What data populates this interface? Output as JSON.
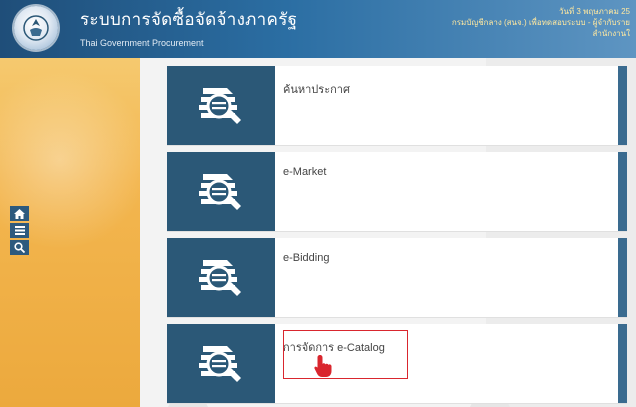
{
  "header": {
    "title_th": "ระบบการจัดซื้อจัดจ้างภาครัฐ",
    "title_en": "Thai Government Procurement",
    "info_line1": "วันที่ 3 พฤษภาคม 25",
    "info_line2": "กรมบัญชีกลาง (สนจ.) เพื่อทดสอบระบบ - ผู้จำกับราย",
    "info_line3": "สำนักงานใ",
    "logo_icon": "government-seal-icon"
  },
  "side_tools": [
    {
      "icon": "home-icon"
    },
    {
      "icon": "menu-icon"
    },
    {
      "icon": "search-icon"
    }
  ],
  "menu": [
    {
      "label": "ค้นหาประกาศ",
      "icon": "search-document-icon"
    },
    {
      "label": "e-Market",
      "icon": "search-document-icon"
    },
    {
      "label": "e-Bidding",
      "icon": "search-document-icon"
    },
    {
      "label": "การจัดการ e-Catalog",
      "icon": "search-document-icon",
      "highlighted": true
    }
  ],
  "colors": {
    "header": "#1f4e79",
    "tile": "#2b5877",
    "stripe": "#3a6b8f",
    "highlight": "#d9262e",
    "cursor": "#d9262e"
  }
}
